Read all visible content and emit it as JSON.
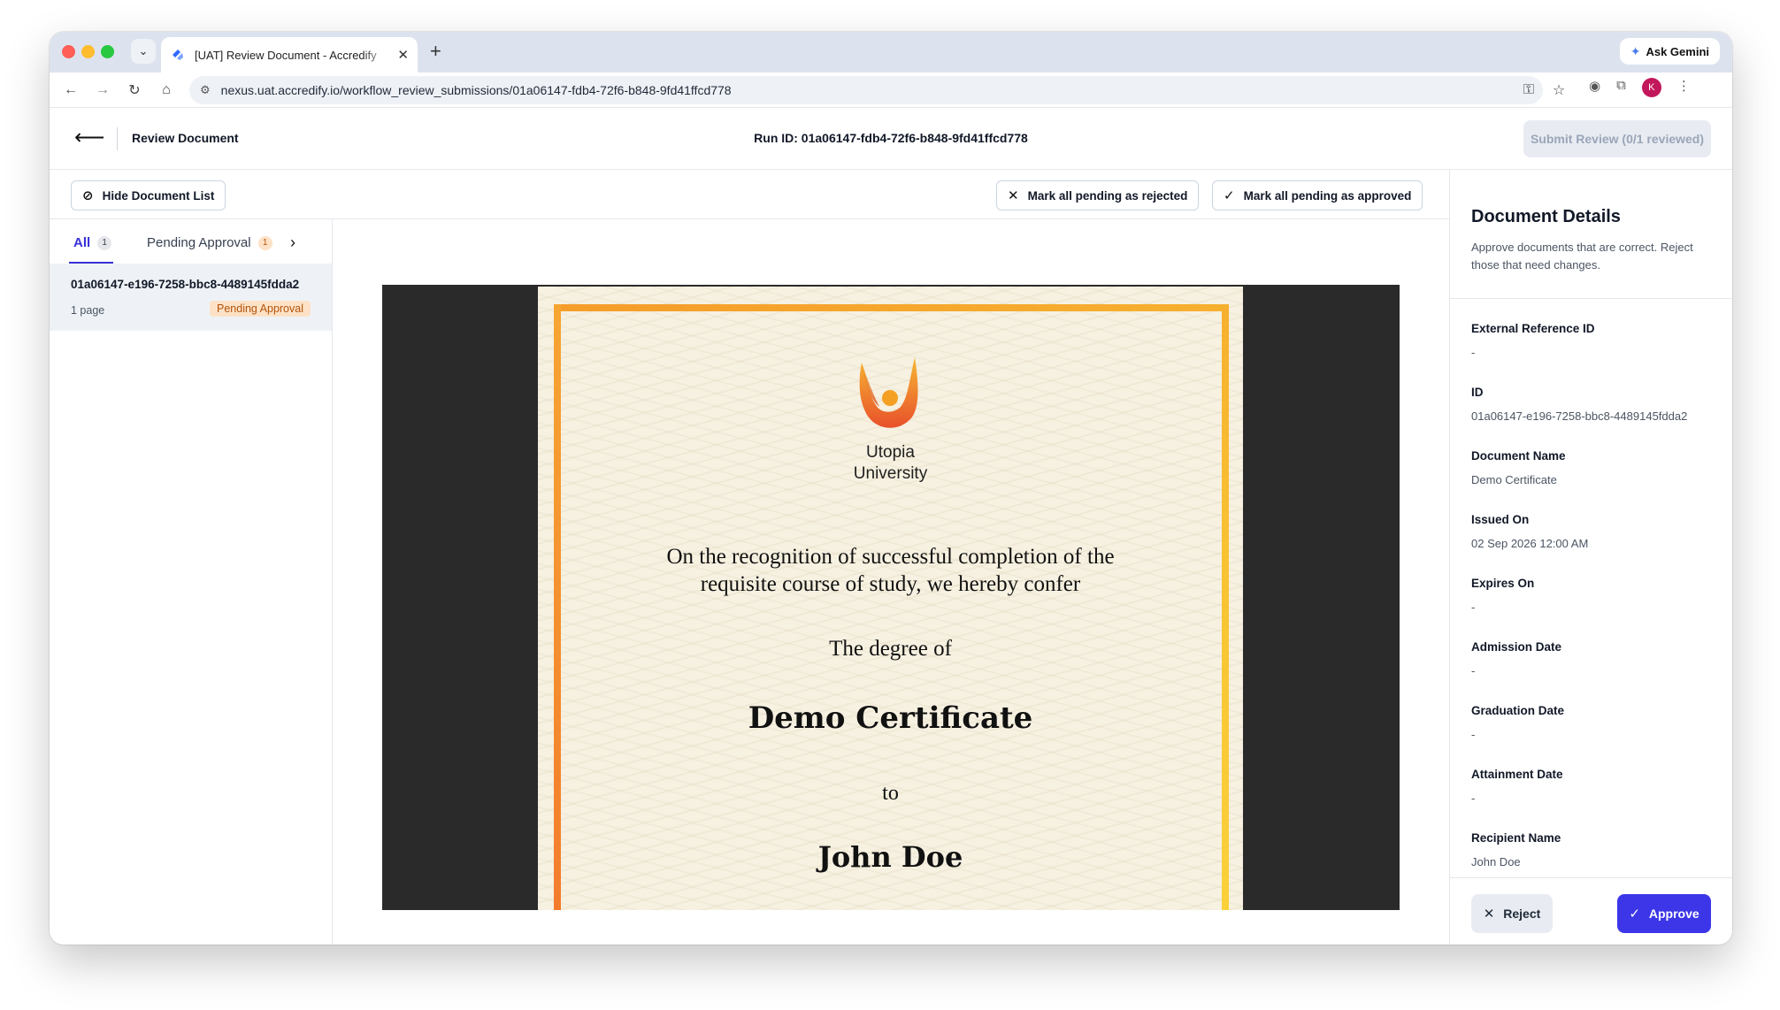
{
  "browser": {
    "tab_title": "[UAT] Review Document - Accredify",
    "new_tab_icon": "+",
    "gemini_label": "Ask Gemini",
    "url": "nexus.uat.accredify.io/workflow_review_submissions/01a06147-fdb4-72f6-b848-9fd41ffcd778",
    "profile_initial": "K"
  },
  "header": {
    "title": "Review Document",
    "run_id": "Run ID: 01a06147-fdb4-72f6-b848-9fd41ffcd778",
    "submit_label": "Submit Review (0/1 reviewed)"
  },
  "actions": {
    "hide_list": "Hide Document List",
    "reject_all": "Mark all pending as rejected",
    "approve_all": "Mark all pending as approved"
  },
  "sidebar": {
    "tabs": [
      {
        "label": "All",
        "count": "1"
      },
      {
        "label": "Pending Approval",
        "count": "1"
      }
    ],
    "documents": [
      {
        "id": "01a06147-e196-7258-bbc8-4489145fdda2",
        "pages": "1 page",
        "status": "Pending Approval"
      }
    ]
  },
  "certificate": {
    "university_line1": "Utopia",
    "university_line2": "University",
    "recognition_line1": "On the recognition of successful completion of the",
    "recognition_line2": "requisite course of study, we hereby confer",
    "degree_of": "The degree of",
    "degree": "Demo Certificate",
    "to": "to",
    "recipient": "John Doe"
  },
  "details": {
    "title": "Document Details",
    "description": "Approve documents that are correct. Reject those that need changes.",
    "fields": [
      {
        "label": "External Reference ID",
        "value": "-"
      },
      {
        "label": "ID",
        "value": "01a06147-e196-7258-bbc8-4489145fdda2"
      },
      {
        "label": "Document Name",
        "value": "Demo Certificate"
      },
      {
        "label": "Issued On",
        "value": "02 Sep 2026 12:00 AM"
      },
      {
        "label": "Expires On",
        "value": "-"
      },
      {
        "label": "Admission Date",
        "value": "-"
      },
      {
        "label": "Graduation Date",
        "value": "-"
      },
      {
        "label": "Attainment Date",
        "value": "-"
      },
      {
        "label": "Recipient Name",
        "value": "John Doe"
      }
    ],
    "reject_label": "Reject",
    "approve_label": "Approve"
  },
  "colors": {
    "accent": "#3c36e8",
    "pending_badge_bg": "#fde2c7",
    "pending_badge_text": "#b45309",
    "viewer_bg": "#2a2a2a"
  }
}
